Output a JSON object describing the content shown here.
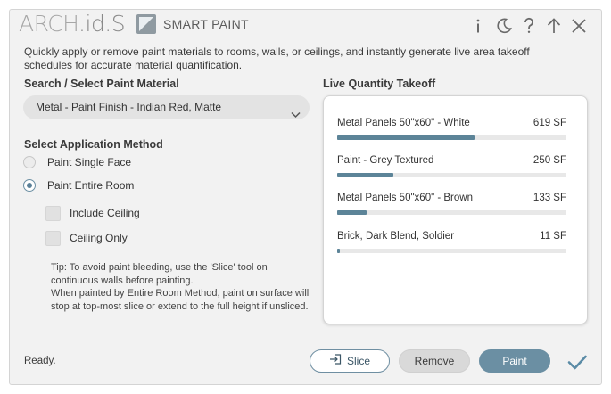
{
  "header": {
    "brand_prefix": "ARCH",
    "brand_suffix": ".id.S",
    "title": "SMART PAINT",
    "icons": [
      "info-icon",
      "moon-icon",
      "help-icon",
      "arrow-up-icon",
      "close-icon"
    ]
  },
  "description": "Quickly apply or remove paint materials to rooms, walls, or ceilings, and instantly generate live area takeoff schedules for accurate material quantification.",
  "search": {
    "label": "Search / Select Paint Material",
    "selected": "Metal - Paint Finish - Indian Red, Matte"
  },
  "method": {
    "label": "Select Application Method",
    "options": [
      {
        "label": "Paint Single Face",
        "selected": false
      },
      {
        "label": "Paint Entire Room",
        "selected": true
      }
    ],
    "checks": [
      {
        "label": "Include Ceiling",
        "checked": false
      },
      {
        "label": "Ceiling Only",
        "checked": false
      }
    ]
  },
  "tip": {
    "lines": [
      "Tip: To avoid paint bleeding, use the 'Slice' tool on",
      "continuous walls before painting.",
      "When painted by Entire Room Method, paint on surface will",
      "stop at top-most slice or extend to the full height if unsliced."
    ]
  },
  "takeoff": {
    "label": "Live Quantity Takeoff",
    "items": [
      {
        "name": "Metal Panels 50\"x60\" - White",
        "value": "619 SF",
        "fraction": 0.6
      },
      {
        "name": "Paint - Grey Textured",
        "value": "250 SF",
        "fraction": 0.245
      },
      {
        "name": "Metal Panels 50\"x60\" - Brown",
        "value": "133 SF",
        "fraction": 0.13
      },
      {
        "name": "Brick, Dark Blend, Soldier",
        "value": "11 SF",
        "fraction": 0.012
      }
    ]
  },
  "footer": {
    "status": "Ready.",
    "slice_label": "Slice",
    "remove_label": "Remove",
    "paint_label": "Paint"
  },
  "colors": {
    "accent": "#6b8fa3",
    "bar_fill": "#5c8498",
    "confirm": "#5a8ba6"
  }
}
